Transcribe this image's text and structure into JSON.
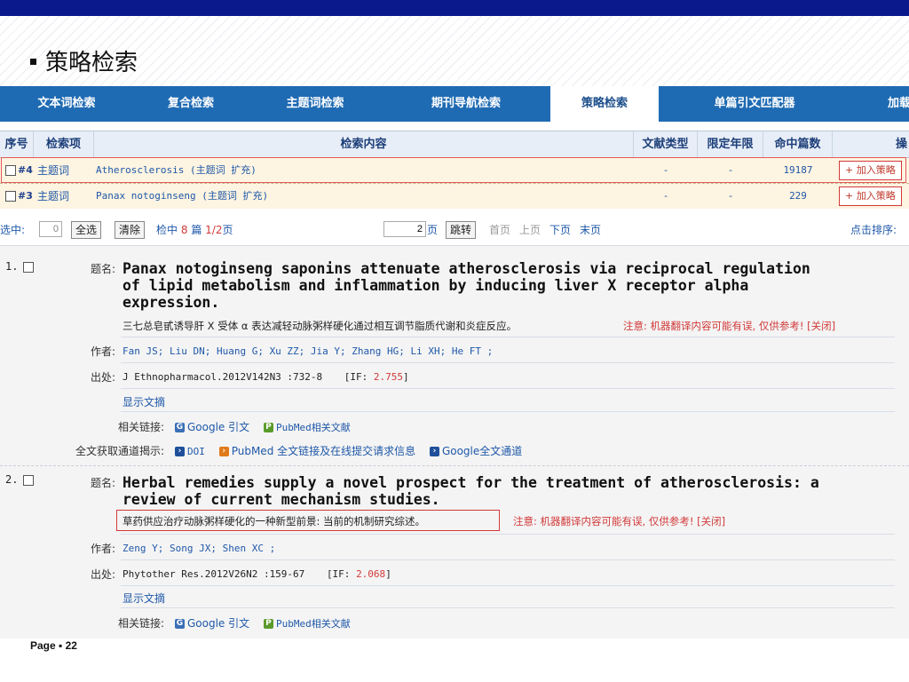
{
  "slide": {
    "title": "策略检索",
    "page": "Page ▪ 22"
  },
  "nav": {
    "items": [
      "文本词检索",
      "复合检索",
      "主题词检索",
      "期刊导航检索",
      "策略检索",
      "单篇引文匹配器",
      "加载"
    ],
    "active_index": 4
  },
  "grid": {
    "headers": [
      "序号",
      "检索项",
      "检索内容",
      "文献类型",
      "限定年限",
      "命中篇数",
      "操"
    ],
    "rows": [
      {
        "num": "#4",
        "field": "主题词",
        "content": "Atherosclerosis (主题词 扩充)",
        "type": "-",
        "years": "-",
        "hits": "19187",
        "action": "+ 加入策略"
      },
      {
        "num": "#3",
        "field": "主题词",
        "content": "Panax notoginseng (主题词 扩充)",
        "type": "-",
        "years": "-",
        "hits": "229",
        "action": "+ 加入策略"
      }
    ]
  },
  "toolbar": {
    "selected_label": "选中:",
    "selected_count": "0",
    "select_all": "全选",
    "clear": "清除",
    "hits_prefix": "检中",
    "hits_count": "8",
    "hits_unit": "篇",
    "page_of": "1/2",
    "page_suffix": "页",
    "goto_value": "2",
    "goto_suffix": "页",
    "goto_button": "跳转",
    "first": "首页",
    "prev": "上页",
    "next": "下页",
    "last": "末页",
    "sort": "点击排序:"
  },
  "labels": {
    "title": "题名:",
    "authors": "作者:",
    "source": "出处:",
    "related": "相关链接:",
    "fulltext": "全文获取通道揭示:",
    "show_abstract": "显示文摘",
    "note": "注意: 机器翻译内容可能有误, 仅供参考! [",
    "close": "关闭",
    "close_end": "]",
    "if_prefix": "[IF: ",
    "if_suffix": "]"
  },
  "links": {
    "google": "Google 引文",
    "pubmed": "PubMed相关文献",
    "doi": "DOI",
    "pubmed_full": "PubMed 全文链接及在线提交请求信息",
    "google_full": "Google全文通道"
  },
  "records": [
    {
      "num": "1.",
      "title_lines": [
        "Panax notoginseng saponins attenuate atherosclerosis via reciprocal regulation",
        "of lipid metabolism and inflammation by inducing liver X receptor alpha",
        "expression."
      ],
      "translation": "三七总皂甙诱导肝 X 受体 α 表达减轻动脉粥样硬化通过相互调节脂质代谢和炎症反应。",
      "authors": "Fan JS; Liu DN; Huang G; Xu ZZ; Jia Y; Zhang HG; Li XH; He FT ;",
      "source": "J Ethnopharmacol.2012V142N3 :732-8",
      "impact_factor": "2.755"
    },
    {
      "num": "2.",
      "title_lines": [
        "Herbal remedies supply a novel prospect for the treatment of atherosclerosis: a",
        "review of current mechanism studies."
      ],
      "translation": "草药供应治疗动脉粥样硬化的一种新型前景: 当前的机制研究综述。",
      "authors": "Zeng Y; Song JX; Shen XC ;",
      "source": "Phytother Res.2012V26N2 :159-67",
      "impact_factor": "2.068"
    }
  ]
}
